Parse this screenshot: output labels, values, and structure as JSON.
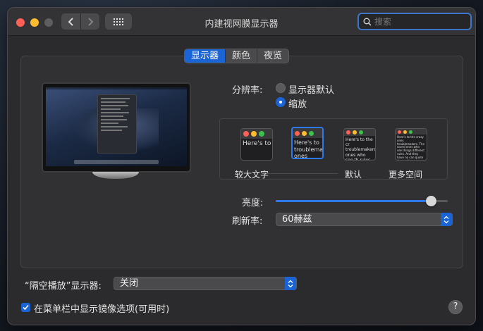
{
  "window": {
    "title": "内建视网膜显示器",
    "search_placeholder": "搜索"
  },
  "tabs": [
    {
      "label": "显示器",
      "active": true
    },
    {
      "label": "颜色",
      "active": false
    },
    {
      "label": "夜览",
      "active": false
    }
  ],
  "resolution": {
    "label": "分辨率:",
    "options": [
      {
        "label": "显示器默认",
        "selected": false
      },
      {
        "label": "缩放",
        "selected": true
      }
    ],
    "scales": [
      {
        "label": "较大文字",
        "preview_text": "Here's to troublem",
        "selected": false
      },
      {
        "label": "",
        "preview_text": "Here's to troublema ones who",
        "selected": true
      },
      {
        "label": "默认",
        "preview_text": "Here's to the cr troublemakers. ones who see th rules. And they",
        "selected": false
      },
      {
        "label": "更多空间",
        "preview_text": "Here's to the crazy ones troublemakers. The round ones who see things different rules. And they have no can quote them, disagree them. About the only thi Because they change th",
        "selected": false
      }
    ]
  },
  "brightness": {
    "label": "亮度:",
    "value": 0.9
  },
  "refresh_rate": {
    "label": "刷新率:",
    "value": "60赫兹"
  },
  "airplay": {
    "label": "“隔空播放”显示器:",
    "value": "关闭"
  },
  "mirror_option": {
    "label": "在菜单栏中显示镜像选项(可用时)",
    "checked": true
  },
  "help": {
    "label": "?"
  },
  "colors": {
    "accent": "#1a64d6",
    "close": "#fe5f57",
    "minimize": "#febc2e"
  }
}
